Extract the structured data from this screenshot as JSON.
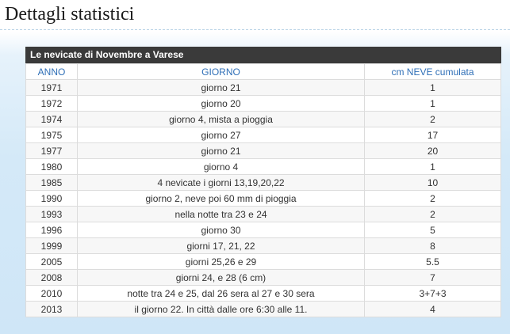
{
  "page": {
    "title": "Dettagli statistici"
  },
  "table": {
    "caption": "Le nevicate di Novembre a Varese",
    "headers": [
      "ANNO",
      "GIORNO",
      "cm NEVE cumulata"
    ],
    "rows": [
      [
        "1971",
        "giorno 21",
        "1"
      ],
      [
        "1972",
        "giorno 20",
        "1"
      ],
      [
        "1974",
        "giorno 4, mista a pioggia",
        "2"
      ],
      [
        "1975",
        "giorno 27",
        "17"
      ],
      [
        "1977",
        "giorno 21",
        "20"
      ],
      [
        "1980",
        "giorno 4",
        "1"
      ],
      [
        "1985",
        "4 nevicate i giorni 13,19,20,22",
        "10"
      ],
      [
        "1990",
        "giorno 2, neve poi 60 mm di pioggia",
        "2"
      ],
      [
        "1993",
        "nella notte tra 23 e 24",
        "2"
      ],
      [
        "1996",
        "giorno 30",
        "5"
      ],
      [
        "1999",
        "giorni 17, 21, 22",
        "8"
      ],
      [
        "2005",
        "giorni 25,26 e 29",
        "5.5"
      ],
      [
        "2008",
        "giorni 24, e 28 (6 cm)",
        "7"
      ],
      [
        "2010",
        "notte tra 24 e 25, dal 26 sera al 27 e 30 sera",
        "3+7+3"
      ],
      [
        "2013",
        "il giorno 22. In città dalle ore 6:30 alle 11.",
        "4"
      ]
    ]
  }
}
